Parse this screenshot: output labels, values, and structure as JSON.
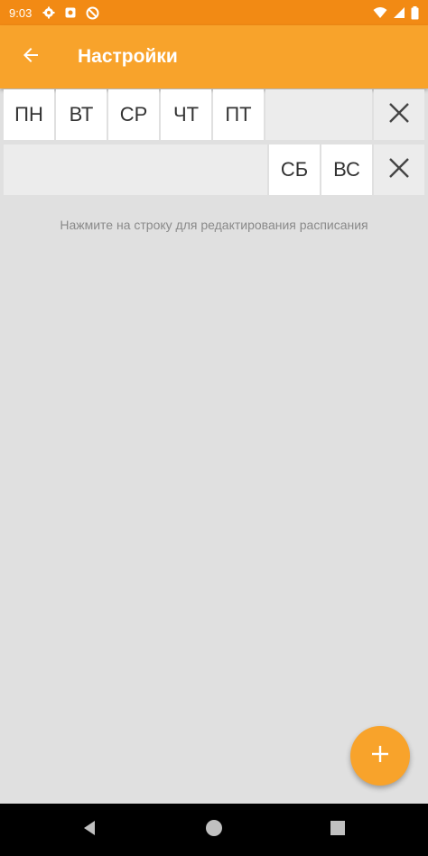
{
  "status_bar": {
    "time": "9:03",
    "icons": [
      "gear-icon",
      "app-notification-icon",
      "no-disturb-icon",
      "wifi-icon",
      "signal-icon",
      "battery-icon"
    ]
  },
  "app_bar": {
    "back_icon": "arrow-left-icon",
    "title": "Настройки"
  },
  "schedule_rows": [
    {
      "days": [
        "ПН",
        "ВТ",
        "СР",
        "ЧТ",
        "ПТ"
      ],
      "remove_icon": "close-icon"
    },
    {
      "days": [
        "СБ",
        "ВС"
      ],
      "remove_icon": "close-icon"
    }
  ],
  "hint": "Нажмите на строку для редактирования расписания",
  "fab": {
    "icon": "plus-icon"
  },
  "nav_bar": {
    "icons": [
      "nav-back-icon",
      "nav-home-icon",
      "nav-recents-icon"
    ]
  },
  "colors": {
    "status_bar": "#f28a14",
    "app_bar": "#f8a32b",
    "background": "#e0e0e0",
    "accent": "#f8a32b"
  }
}
